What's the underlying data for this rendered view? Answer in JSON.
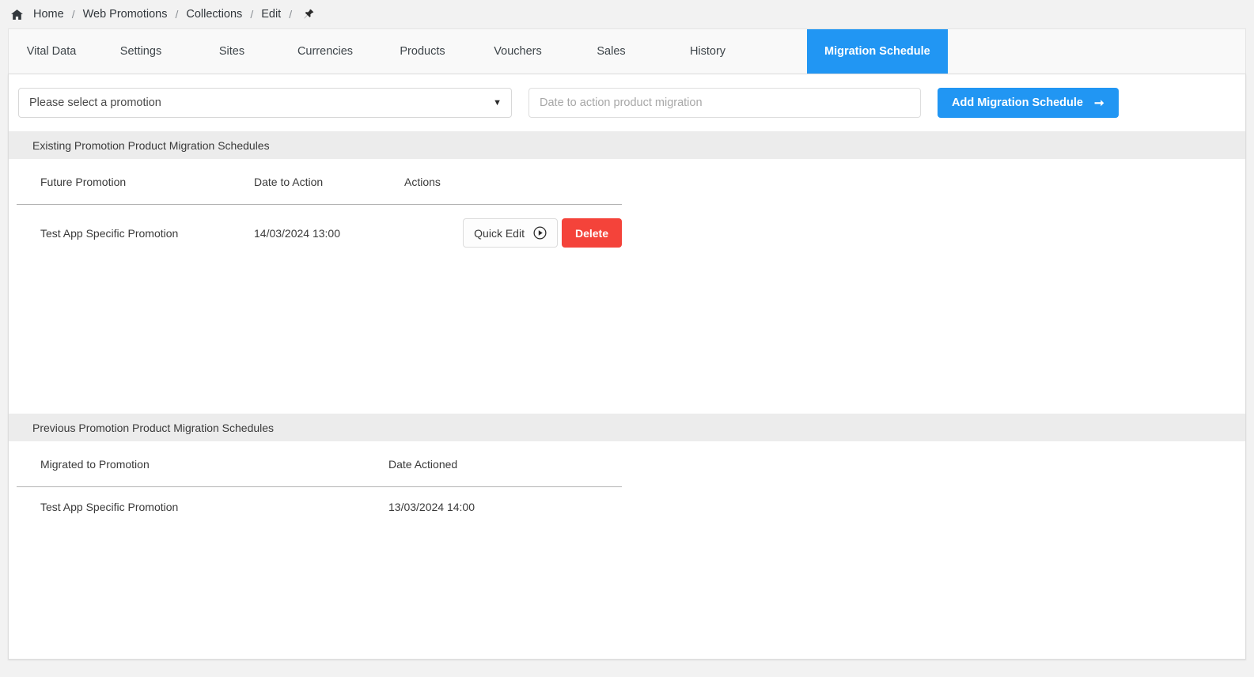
{
  "breadcrumb": {
    "home_icon": "home-icon",
    "items": [
      "Home",
      "Web Promotions",
      "Collections",
      "Edit"
    ],
    "separator": "/",
    "pin_icon": "pin-icon"
  },
  "tabs": [
    {
      "label": "Vital Data",
      "active": false
    },
    {
      "label": "Settings",
      "active": false
    },
    {
      "label": "Sites",
      "active": false
    },
    {
      "label": "Currencies",
      "active": false
    },
    {
      "label": "Products",
      "active": false
    },
    {
      "label": "Vouchers",
      "active": false
    },
    {
      "label": "Sales",
      "active": false
    },
    {
      "label": "History",
      "active": false
    },
    {
      "label": "Migration Schedule",
      "active": true
    }
  ],
  "toolbar": {
    "promotion_select": {
      "selected": "Please select a promotion",
      "options": [
        "Please select a promotion"
      ],
      "caret_icon": "chevron-down-icon"
    },
    "date_input": {
      "value": "",
      "placeholder": "Date to action product migration"
    },
    "add_button": {
      "label": "Add Migration Schedule",
      "arrow_icon": "arrow-right-icon"
    }
  },
  "existing_section": {
    "title": "Existing Promotion Product Migration Schedules",
    "columns": [
      "Future Promotion",
      "Date to Action",
      "Actions"
    ],
    "rows": [
      {
        "promotion": "Test App Specific Promotion",
        "date_to_action": "14/03/2024 13:00",
        "quick_edit_label": "Quick Edit",
        "quick_edit_icon": "play-circle-icon",
        "delete_label": "Delete"
      }
    ]
  },
  "previous_section": {
    "title": "Previous Promotion Product Migration Schedules",
    "columns": [
      "Migrated to Promotion",
      "Date Actioned"
    ],
    "rows": [
      {
        "promotion": "Test App Specific Promotion",
        "date_actioned": "13/03/2024 14:00"
      }
    ]
  },
  "colors": {
    "accent_blue": "#2196f3",
    "danger_red": "#f4433a",
    "section_bar": "#ececec",
    "page_bg": "#f2f2f2"
  }
}
